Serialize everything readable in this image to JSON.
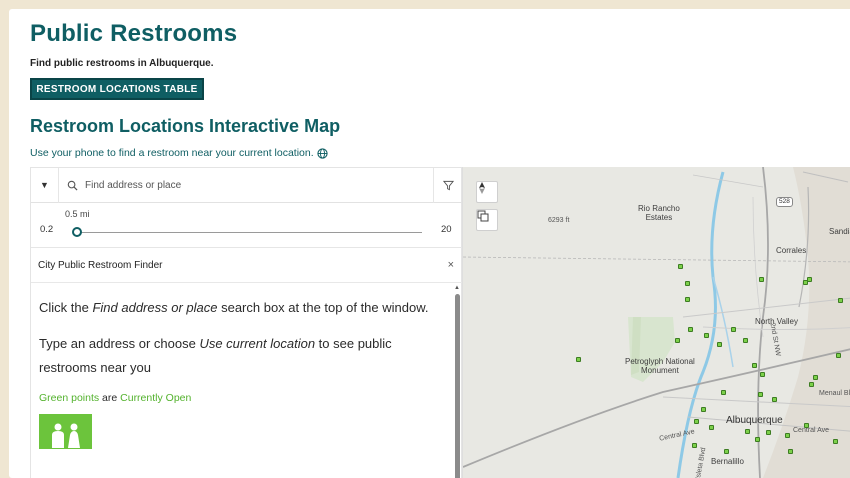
{
  "header": {
    "title": "Public Restrooms",
    "subtitle": "Find public restrooms in Albuquerque.",
    "table_button": "RESTROOM LOCATIONS TABLE"
  },
  "map_section": {
    "title": "Restroom Locations Interactive Map",
    "hint": "Use your phone to find a restroom near your current location."
  },
  "search": {
    "placeholder": "Find address or place"
  },
  "distance_slider": {
    "min": "0.2",
    "max": "20",
    "value_label": "0.5 mi",
    "value": 0.5
  },
  "card": {
    "title": "City Public Restroom Finder",
    "close": "×",
    "p1_pre": "Click the ",
    "p1_em": "Find address or place",
    "p1_post": " search box at the top of the window.",
    "p2_pre": "Type an address or choose ",
    "p2_em": "Use current location",
    "p2_post": " to see public restrooms near you",
    "legend_a": "Green points",
    "legend_b": " are ",
    "legend_c": "Currently Open"
  },
  "map": {
    "labels": {
      "rio_rancho": "Rio Rancho\nEstates",
      "corrales": "Corrales",
      "sandia": "Sandia P",
      "north_valley": "North Valley",
      "petroglyph": "Petroglyph National\nMonument",
      "albuquerque": "Albuquerque",
      "bernalillo": "Bernalillo",
      "menaul": "Menaul Blvd",
      "central_w": "Central Ave",
      "central_e": "Central Ave",
      "elevation": "6293 ft",
      "second_st": "2nd St NW",
      "fourth_st": "4th St NW",
      "isleta": "Isleta Blvd"
    },
    "shields": [
      "528"
    ],
    "colors": {
      "open_point": "#7cd04a",
      "river": "#8ec9e6",
      "brand": "#0f5e63"
    }
  }
}
